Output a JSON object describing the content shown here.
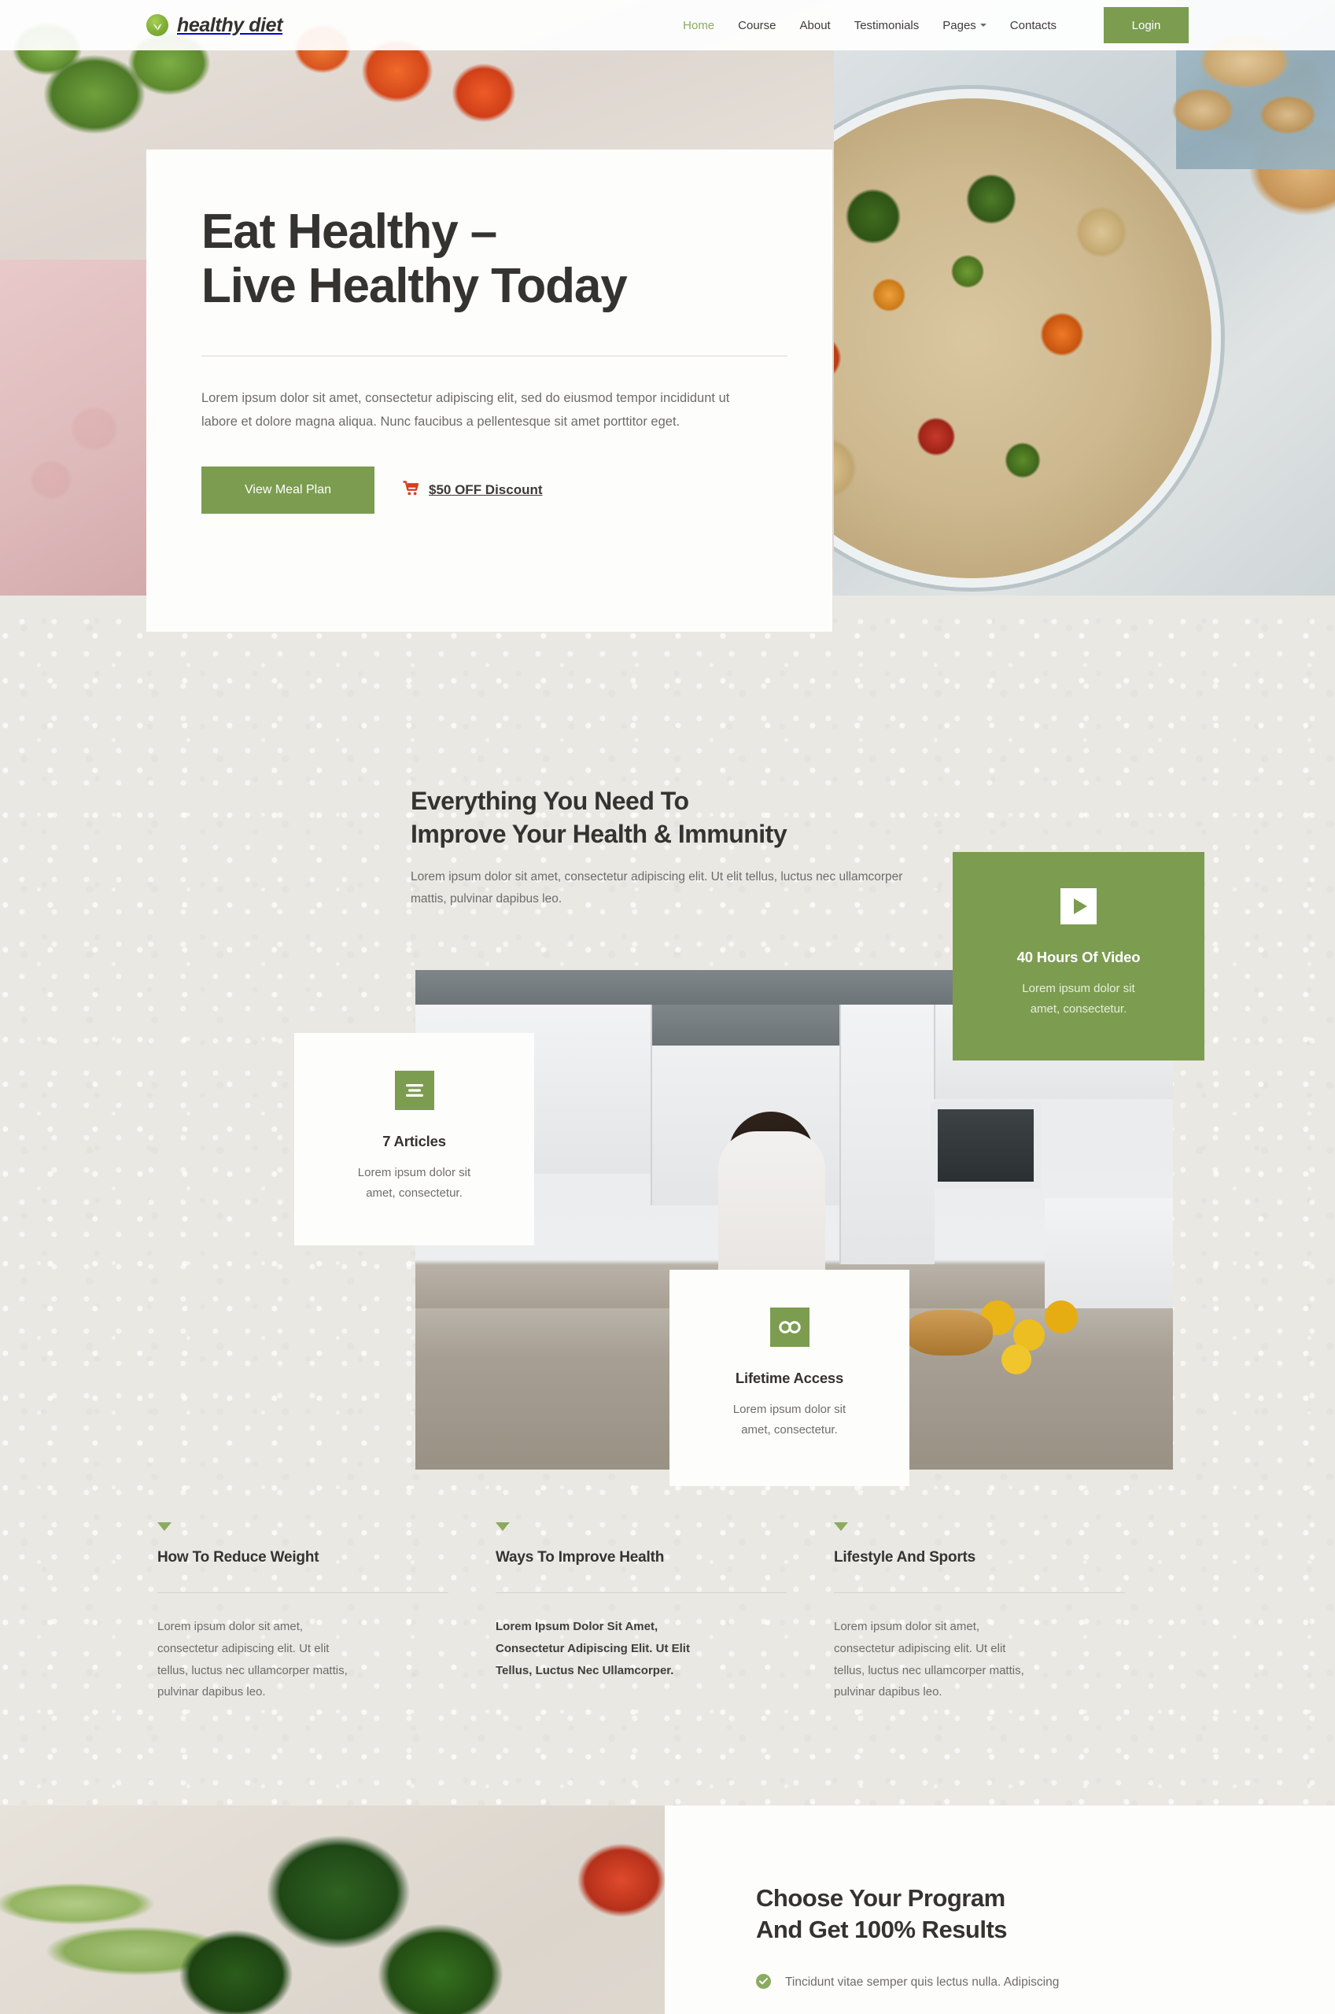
{
  "header": {
    "brand": "healthy diet",
    "brand_icon": "leaf-circle-icon",
    "nav": [
      {
        "label": "Home",
        "active": true
      },
      {
        "label": "Course",
        "active": false
      },
      {
        "label": "About",
        "active": false
      },
      {
        "label": "Testimonials",
        "active": false
      },
      {
        "label": "Pages",
        "active": false,
        "has_dropdown": true
      },
      {
        "label": "Contacts",
        "active": false
      }
    ],
    "login_label": "Login"
  },
  "hero": {
    "title": "Eat Healthy –\nLive Healthy Today",
    "body": "Lorem ipsum dolor sit amet, consectetur adipiscing elit, sed do eiusmod tempor incididunt ut labore et dolore magna aliqua. Nunc faucibus a pellentesque sit amet porttitor eget.",
    "primary_button": "View Meal Plan",
    "discount_label": "$50 OFF Discount",
    "discount_icon": "shopping-cart-icon"
  },
  "features": {
    "title": "Everything You Need To\nImprove Your Health & Immunity",
    "subtitle": "Lorem ipsum dolor sit amet, consectetur adipiscing elit. Ut elit tellus, luctus nec ullamcorper mattis, pulvinar dapibus leo.",
    "cards": [
      {
        "title": "40 Hours Of Video",
        "text": "Lorem ipsum dolor sit\namet, consectetur.",
        "icon": "play-icon",
        "style": "green"
      },
      {
        "title": "7 Articles",
        "text": "Lorem ipsum dolor sit\namet, consectetur.",
        "icon": "article-lines-icon",
        "style": "white"
      },
      {
        "title": "Lifetime Access",
        "text": "Lorem ipsum dolor sit\namet, consectetur.",
        "icon": "infinity-icon",
        "style": "white"
      }
    ]
  },
  "columns": [
    {
      "title": "How To Reduce Weight",
      "text": "Lorem ipsum dolor sit amet,\nconsectetur adipiscing elit. Ut elit\ntellus, luctus nec ullamcorper mattis,\npulvinar dapibus leo.",
      "bold": false,
      "marker": "triangle-down-icon"
    },
    {
      "title": "Ways To Improve Health",
      "text": "Lorem Ipsum Dolor Sit Amet,\nConsectetur Adipiscing Elit. Ut Elit\nTellus, Luctus Nec Ullamcorper.",
      "bold": true,
      "marker": "triangle-down-icon"
    },
    {
      "title": "Lifestyle And Sports",
      "text": "Lorem ipsum dolor sit amet,\nconsectetur adipiscing elit. Ut elit\ntellus, luctus nec ullamcorper mattis,\npulvinar dapibus leo.",
      "bold": false,
      "marker": "triangle-down-icon"
    }
  ],
  "program": {
    "title": "Choose Your Program\nAnd Get 100% Results",
    "bullet_icon": "check-circle-icon",
    "bullet_text": "Tincidunt vitae semper quis lectus nulla. Adipiscing"
  },
  "colors": {
    "brand_green": "#7c9c50",
    "accent_green": "#8aab60",
    "page_background": "#eae8e3",
    "card_background": "#fdfdfc",
    "heading": "#34332f",
    "body_text": "#6d6c68",
    "cart_red": "#d2401f"
  }
}
